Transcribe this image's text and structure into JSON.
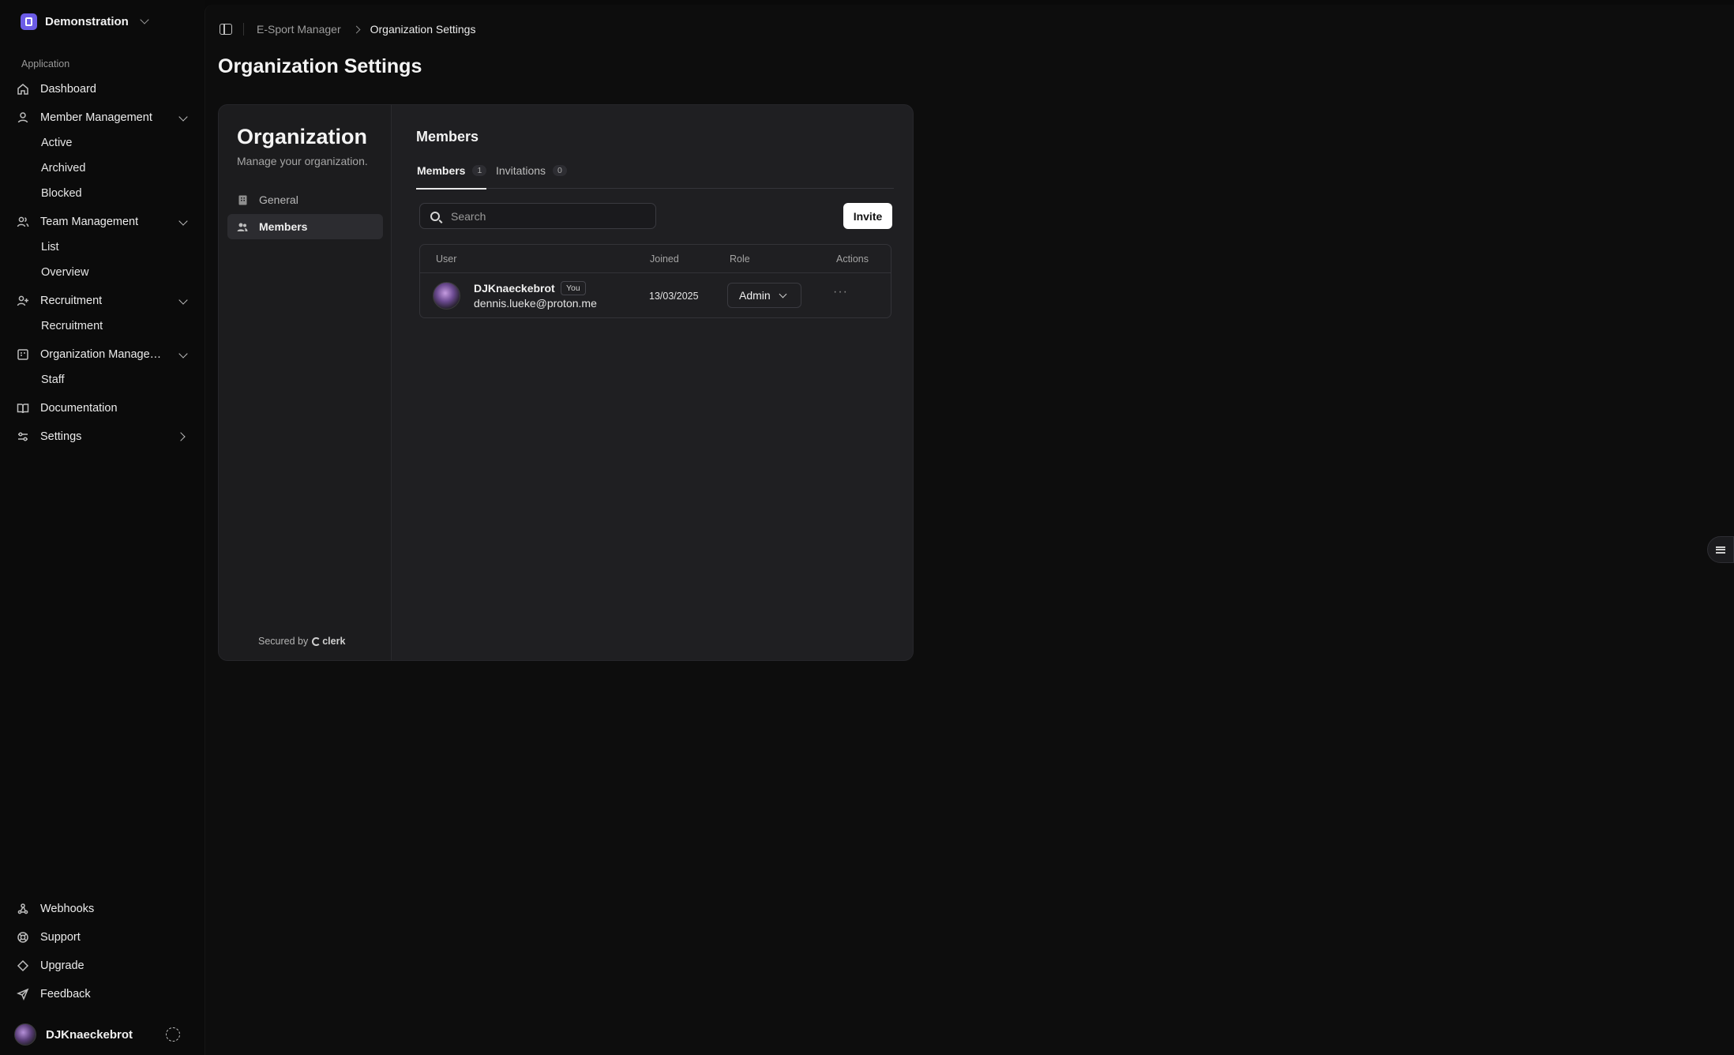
{
  "workspace": {
    "name": "Demonstration"
  },
  "sidebar": {
    "section_label": "Application",
    "items": [
      {
        "label": "Dashboard",
        "icon": "home-icon"
      },
      {
        "label": "Member Management",
        "icon": "user-icon",
        "sub": [
          "Active",
          "Archived",
          "Blocked"
        ]
      },
      {
        "label": "Team Management",
        "icon": "users-icon",
        "sub": [
          "List",
          "Overview"
        ]
      },
      {
        "label": "Recruitment",
        "icon": "user-plus-icon",
        "sub": [
          "Recruitment"
        ]
      },
      {
        "label": "Organization Management",
        "icon": "building-icon",
        "sub": [
          "Staff"
        ]
      },
      {
        "label": "Documentation",
        "icon": "book-icon"
      },
      {
        "label": "Settings",
        "icon": "sliders-icon"
      }
    ],
    "footer_items": [
      {
        "label": "Webhooks",
        "icon": "webhook-icon"
      },
      {
        "label": "Support",
        "icon": "lifebuoy-icon"
      },
      {
        "label": "Upgrade",
        "icon": "diamond-icon"
      },
      {
        "label": "Feedback",
        "icon": "send-icon"
      }
    ],
    "user": {
      "name": "DJKnaeckebrot"
    }
  },
  "breadcrumb": {
    "parent": "E-Sport Manager",
    "current": "Organization Settings"
  },
  "page_title": "Organization Settings",
  "org_card": {
    "title": "Organization",
    "subtitle": "Manage your organization.",
    "nav": [
      {
        "label": "General",
        "icon": "building-icon"
      },
      {
        "label": "Members",
        "icon": "users-icon",
        "active": true
      }
    ],
    "secured_by": "Secured by",
    "brand": "clerk",
    "section_title": "Members",
    "tabs": [
      {
        "label": "Members",
        "count": "1",
        "active": true
      },
      {
        "label": "Invitations",
        "count": "0"
      }
    ],
    "search_placeholder": "Search",
    "invite_label": "Invite",
    "columns": [
      "User",
      "Joined",
      "Role",
      "Actions"
    ],
    "rows": [
      {
        "name": "DJKnaeckebrot",
        "tag": "You",
        "email": "dennis.lueke@proton.me",
        "joined": "13/03/2025",
        "role": "Admin",
        "actions": "···"
      }
    ]
  },
  "colors": {
    "accent": "#6c5ce7",
    "background": "#0a0a0a",
    "card": "#1f1f22"
  }
}
